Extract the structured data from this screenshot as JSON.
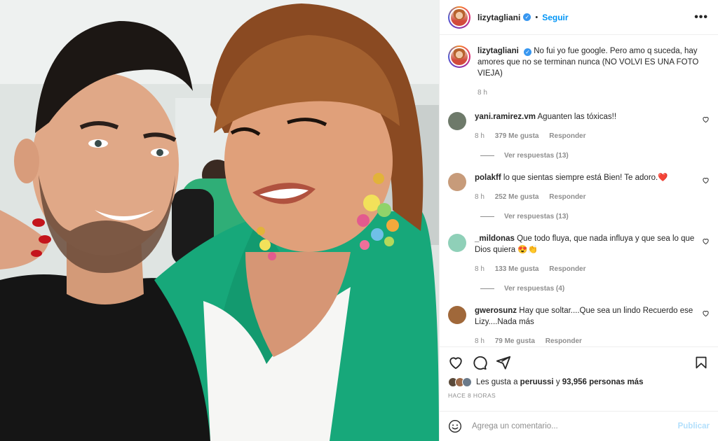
{
  "post": {
    "photo_alt": "",
    "author": {
      "username": "lizytagliani",
      "verified": true,
      "follow_label": "Seguir",
      "separator": "•",
      "more_label": "•••"
    },
    "caption": {
      "username": "lizytagliani",
      "text": "No fui yo fue google. Pero amo q suceda, hay amores que no se terminan nunca (NO VOLVI ES UNA FOTO VIEJA)",
      "time": "8 h"
    },
    "comments": [
      {
        "username": "yani.ramirez.vm",
        "text": "Aguanten las tóxicas!!",
        "time": "8 h",
        "likes": "379 Me gusta",
        "reply_label": "Responder",
        "view_replies": "Ver respuestas (13)",
        "avatar_color": "#6e7a6a"
      },
      {
        "username": "polakff",
        "text": "lo que sientas siempre está Bien! Te adoro.❤️",
        "time": "8 h",
        "likes": "252 Me gusta",
        "reply_label": "Responder",
        "view_replies": "Ver respuestas (13)",
        "avatar_color": "#c79b7a"
      },
      {
        "username": "_mildonas",
        "text": "Que todo fluya, que nada influya y que sea lo que Dios quiera 😍👏",
        "time": "8 h",
        "likes": "133 Me gusta",
        "reply_label": "Responder",
        "view_replies": "Ver respuestas (4)",
        "avatar_color": "#8fd0b8"
      },
      {
        "username": "gwerosunz",
        "text": "Hay que soltar....Que sea un lindo Recuerdo ese Lizy....Nada más",
        "time": "8 h",
        "likes": "79 Me gusta",
        "reply_label": "Responder",
        "view_replies": "",
        "avatar_color": "#a0683a"
      }
    ],
    "likes": {
      "prefix": "Les gusta a",
      "user": "peruussi",
      "conjunction": "y",
      "count": "93,956 personas más"
    },
    "time_ago": "HACE 8 HORAS",
    "add_comment": {
      "placeholder": "Agrega un comentario...",
      "publish_label": "Publicar"
    }
  },
  "colors": {
    "link_blue": "#0095f6",
    "verified_blue": "#3897f0",
    "muted_text": "#8e8e8e",
    "publish_disabled": "#b2dffc"
  },
  "icons": [
    "more-options-icon",
    "verified-badge-icon",
    "heart-icon",
    "comment-icon",
    "share-icon",
    "save-icon",
    "emoji-icon"
  ]
}
